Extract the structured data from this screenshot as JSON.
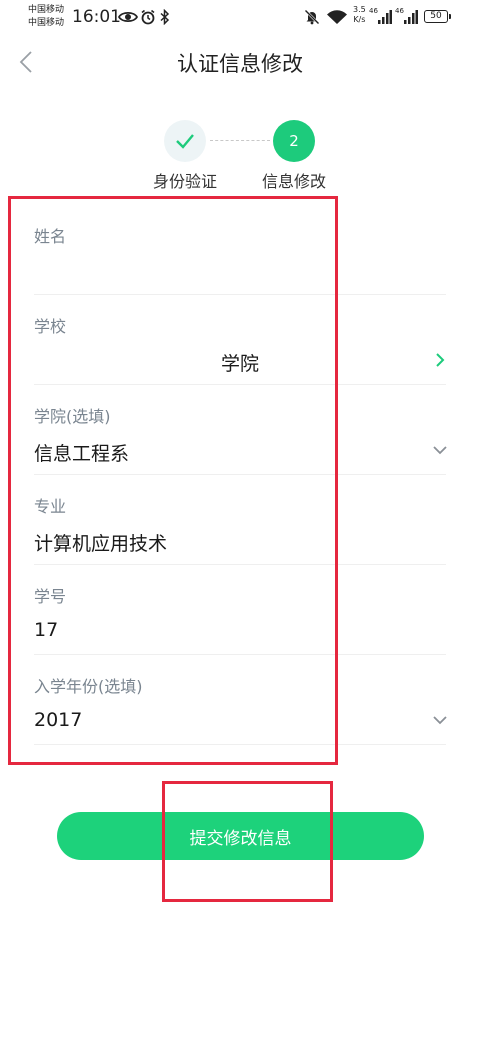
{
  "status_bar": {
    "carrier_1": "中国移动",
    "carrier_2": "中国移动",
    "time": "16:01",
    "speed_value": "3.5",
    "speed_unit": "K/s",
    "network_1": "46",
    "network_2": "46",
    "battery": "50"
  },
  "nav": {
    "title": "认证信息修改"
  },
  "stepper": {
    "step1_label": "身份验证",
    "step2_number": "2",
    "step2_label": "信息修改",
    "active_color": "#1dcb7c"
  },
  "form": {
    "name": {
      "label": "姓名",
      "value": ""
    },
    "school": {
      "label": "学校",
      "value": "学院"
    },
    "college": {
      "label": "学院(选填)",
      "value": "信息工程系"
    },
    "major": {
      "label": "专业",
      "value": "计算机应用技术"
    },
    "student_id": {
      "label": "学号",
      "value": "17"
    },
    "enroll_year": {
      "label": "入学年份(选填)",
      "value": "2017"
    }
  },
  "submit": {
    "label": "提交修改信息",
    "color": "#1dd27b"
  },
  "annotation_color": "#e5283f"
}
